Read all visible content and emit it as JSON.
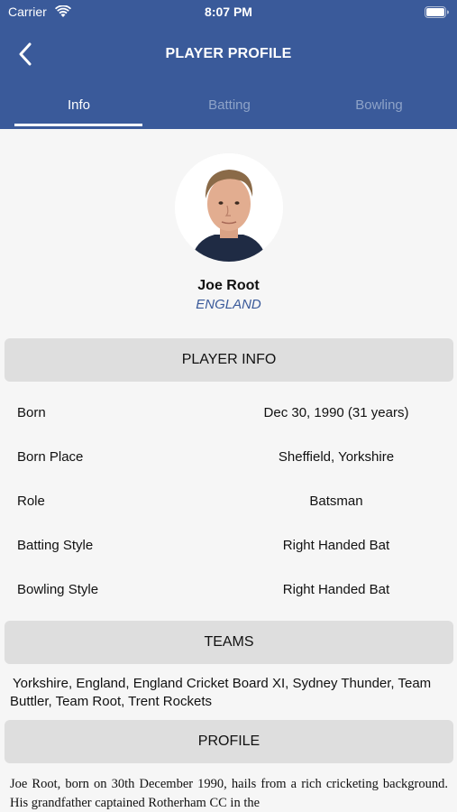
{
  "status_bar": {
    "carrier": "Carrier",
    "time": "8:07 PM"
  },
  "nav": {
    "title": "PLAYER PROFILE"
  },
  "tabs": [
    {
      "label": "Info",
      "active": true
    },
    {
      "label": "Batting",
      "active": false
    },
    {
      "label": "Bowling",
      "active": false
    }
  ],
  "player": {
    "name": "Joe Root",
    "country": "ENGLAND"
  },
  "sections": {
    "player_info": "PLAYER INFO",
    "teams": "TEAMS",
    "profile": "PROFILE"
  },
  "info": [
    {
      "label": "Born",
      "value": "Dec 30, 1990 (31 years)"
    },
    {
      "label": "Born Place",
      "value": "Sheffield, Yorkshire"
    },
    {
      "label": "Role",
      "value": "Batsman"
    },
    {
      "label": "Batting Style",
      "value": "Right Handed Bat"
    },
    {
      "label": "Bowling Style",
      "value": "Right Handed Bat"
    }
  ],
  "teams_text": "Yorkshire, England, England Cricket Board XI, Sydney Thunder, Team Buttler, Team Root, Trent Rockets",
  "profile_text": "Joe Root, born on 30th December 1990, hails from a rich cricketing background. His grandfather captained Rotherham CC in the",
  "colors": {
    "header": "#3a5a9a",
    "inactive_tab": "#8ea3c8",
    "section_bg": "#dedede",
    "page_bg": "#f6f6f6"
  }
}
